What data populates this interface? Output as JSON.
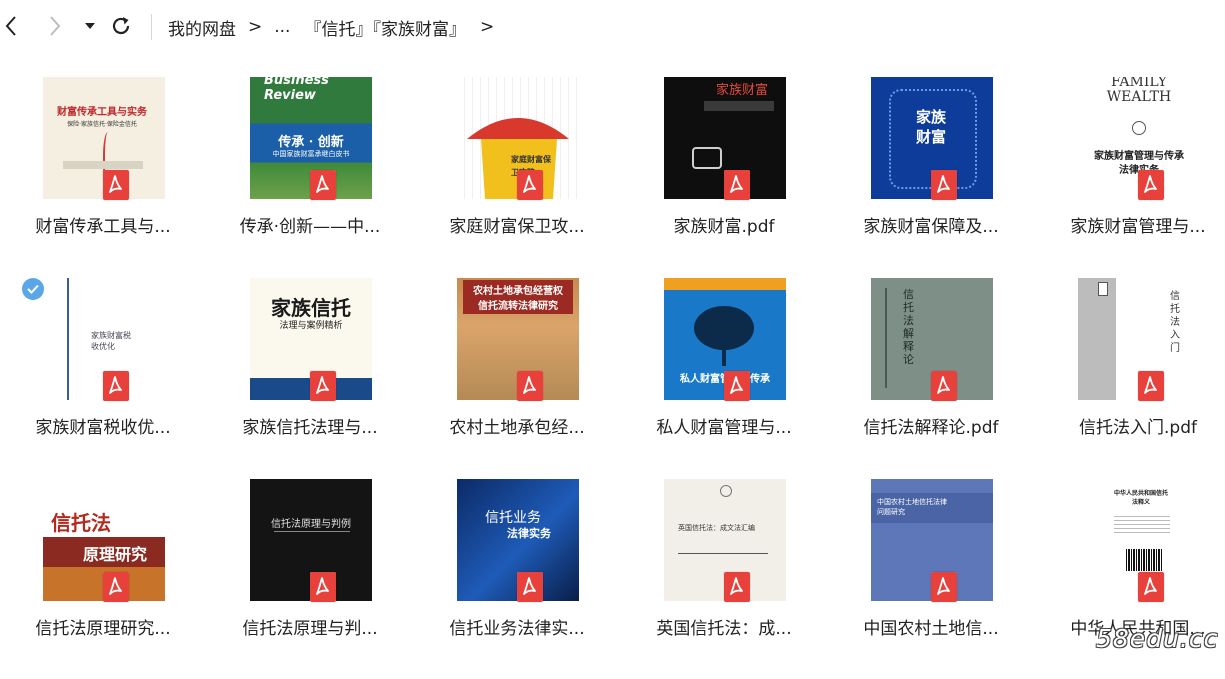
{
  "breadcrumb": {
    "items": [
      "我的网盘",
      "...",
      "『信托』『家族财富』"
    ],
    "separator": ">"
  },
  "files": [
    {
      "name": "财富传承工具与...",
      "cover_title": "财富传承工具与实务",
      "cover_subtitle": "保险·家族信托·保险金信托"
    },
    {
      "name": "传承·创新——中...",
      "cover_title": "传承 · 创新",
      "cover_subtitle": "中国家族财富承继白皮书",
      "cover_brand": "Business Review"
    },
    {
      "name": "家庭财富保卫攻...",
      "cover_title": "家庭财富保卫攻略"
    },
    {
      "name": "家族财富.pdf",
      "cover_title": "家族财富"
    },
    {
      "name": "家族财富保障及...",
      "cover_title": "家族财富"
    },
    {
      "name": "家族财富管理与...",
      "cover_brand": "FAMILY WEALTH",
      "cover_title": "家族财富管理与传承",
      "cover_subtitle": "法律实务"
    },
    {
      "name": "家族财富税收优...",
      "cover_title": "家族财富税收优化",
      "checked": true
    },
    {
      "name": "家族信托法理与...",
      "cover_title": "家族信托",
      "cover_subtitle": "法理与案例精析"
    },
    {
      "name": "农村土地承包经...",
      "cover_title": "农村土地承包经营权",
      "cover_subtitle": "信托流转法律研究"
    },
    {
      "name": "私人财富管理与...",
      "cover_title": "私人财富管理与传承"
    },
    {
      "name": "信托法解释论.pdf",
      "cover_title": "信托法解释论"
    },
    {
      "name": "信托法入门.pdf",
      "cover_title": "信托法入门"
    },
    {
      "name": "信托法原理研究...",
      "cover_title": "信托法",
      "cover_subtitle": "原理研究"
    },
    {
      "name": "信托法原理与判...",
      "cover_title": "信托法原理与判例"
    },
    {
      "name": "信托业务法律实...",
      "cover_title": "信托业务",
      "cover_subtitle": "法律实务"
    },
    {
      "name": "英国信托法：成...",
      "cover_title": "英国信托法：成文法汇编"
    },
    {
      "name": "中国农村土地信...",
      "cover_title": "中国农村土地信托法律问题研究"
    },
    {
      "name": "中华人民共和国...",
      "cover_title": "中华人民共和国信托法释义"
    }
  ],
  "watermark": "58edu.cc",
  "colors": {
    "pdf_red": "#e8403a",
    "check_blue": "#5aa7e8"
  },
  "icons": {
    "back": "chevron-left-icon",
    "forward": "chevron-right-icon",
    "dropdown": "caret-down-icon",
    "refresh": "refresh-icon",
    "pdf": "pdf-icon"
  }
}
